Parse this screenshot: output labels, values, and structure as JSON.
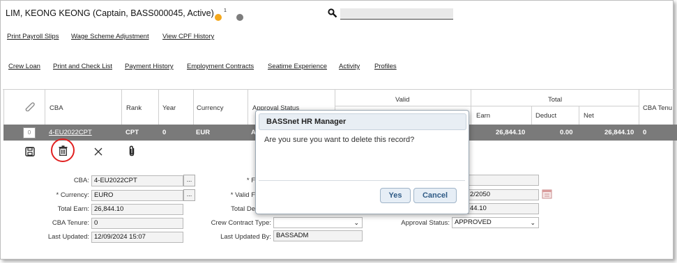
{
  "header": {
    "title": "LIM, KEONG KEONG (Captain, BASS000045, Active)",
    "notification_count": "1",
    "colors": {
      "notification": "#f4a81c",
      "status": "#7d7d7d"
    }
  },
  "links_row1": [
    "Print Payroll Slips",
    "Wage Scheme Adjustment",
    "View CPF History"
  ],
  "links_row2": [
    "Crew Loan",
    "Print and Check List",
    "Payment History",
    "Employment Contracts",
    "Seatime Experience",
    "Activity",
    "Profiles"
  ],
  "grid": {
    "columns": {
      "cba": "CBA",
      "rank": "Rank",
      "year": "Year",
      "currency": "Currency",
      "approval_status": "Approval Status",
      "valid": "Valid",
      "total": "Total",
      "earn": "Earn",
      "deduct": "Deduct",
      "net": "Net",
      "cba_tenure": "CBA Tenu"
    },
    "row": {
      "checkbox": "0",
      "cba": "4-EU2022CPT",
      "rank": "CPT",
      "year": "0",
      "currency": "EUR",
      "approval_status": "A",
      "earn": "26,844.10",
      "deduct": "0.00",
      "net": "26,844.10",
      "cba_tenure": "0"
    }
  },
  "toolbar": {
    "icons": [
      "save-icon",
      "trash-icon",
      "close-icon",
      "attach-icon"
    ]
  },
  "form": {
    "cba_label": "CBA:",
    "cba_value": "4-EU2022CPT",
    "currency_label": "* Currency:",
    "currency_value": "EURO",
    "total_earn_label": "Total Earn:",
    "total_earn_value": "26,844.10",
    "cba_tenure_label": "CBA Tenure:",
    "cba_tenure_value": "0",
    "last_updated_label": "Last Updated:",
    "last_updated_value": "12/09/2024 15:07",
    "col2_r1_label": "* F",
    "valid_label": "* Valid F",
    "total_de_label": "Total De",
    "crew_contract_type_label": "Crew Contract Type:",
    "crew_contract_type_value": "",
    "last_updated_by_label": "Last Updated By:",
    "last_updated_by_value": "BASSADM",
    "col3_r2_value": "2/2050",
    "col3_r3_value": "44.10",
    "approval_status_label": "Approval Status:",
    "approval_status_value": "APPROVED"
  },
  "dialog": {
    "title": "BASSnet HR Manager",
    "message": "Are you sure you want to delete this record?",
    "yes_label": "Yes",
    "cancel_label": "Cancel"
  }
}
